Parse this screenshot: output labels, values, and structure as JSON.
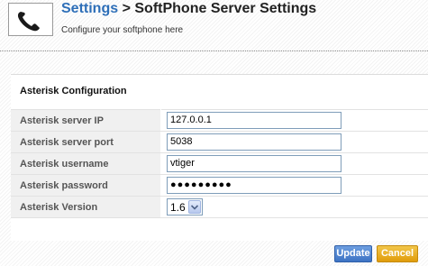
{
  "header": {
    "title_link": "Settings",
    "title_separator": ">",
    "title_page": "SoftPhone Server Settings",
    "subtitle": "Configure your softphone here"
  },
  "section": {
    "title": "Asterisk Configuration"
  },
  "fields": [
    {
      "label": "Asterisk server IP",
      "value": "127.0.0.1"
    },
    {
      "label": "Asterisk server port",
      "value": "5038"
    },
    {
      "label": "Asterisk username",
      "value": "vtiger"
    },
    {
      "label": "Asterisk password",
      "value": "●●●●●●●●●"
    },
    {
      "label": "Asterisk Version",
      "value": "1.6"
    }
  ],
  "buttons": {
    "update_label": "Update",
    "cancel_label": "Cancel"
  },
  "colors": {
    "title_link": "#2e6fb8",
    "update_button": "#3d73c4",
    "cancel_button": "#e09c0b"
  },
  "icons": {
    "header_icon": "telephone-icon",
    "select_arrow": "chevron-down-icon"
  }
}
